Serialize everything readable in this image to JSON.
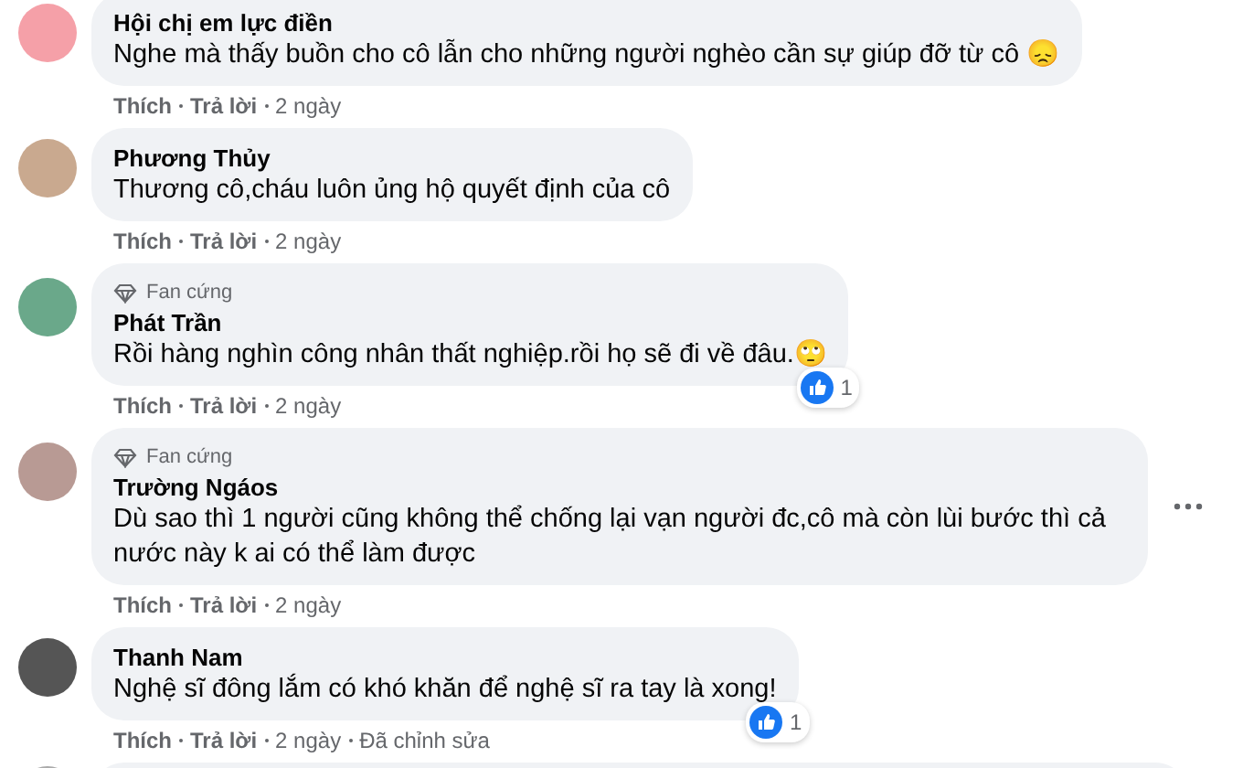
{
  "comments": [
    {
      "author": "Hội chị em lực điền",
      "text": "Nghe mà thấy buồn cho cô lẫn cho những người nghèo cần sự giúp đỡ từ cô 😞",
      "actions": [
        "Thích",
        "Trả lời"
      ],
      "time": "2 ngày",
      "has_menu": false
    },
    {
      "author": "Phương Thủy",
      "text": "Thương cô,cháu luôn ủng hộ quyết định của cô",
      "actions": [
        "Thích",
        "Trả lời"
      ],
      "time": "2 ngày",
      "has_menu": false
    },
    {
      "author": "Phát Trần",
      "badge": "Fan cứng",
      "text": "Rồi hàng nghìn công nhân thất nghiệp.rồi họ sẽ đi về đâu.🙄",
      "actions": [
        "Thích",
        "Trả lời"
      ],
      "time": "2 ngày",
      "reaction_count": "1",
      "has_menu": false
    },
    {
      "author": "Trường Ngáos",
      "badge": "Fan cứng",
      "text": "Dù sao thì 1 người cũng không thể chống lại vạn người đc,cô mà còn lùi bước thì cả nước này k ai có thể làm được",
      "actions": [
        "Thích",
        "Trả lời"
      ],
      "time": "2 ngày",
      "has_menu": true
    },
    {
      "author": "Thanh Nam",
      "text": "Nghệ sĩ đông lắm có khó khăn để nghệ sĩ ra tay là xong!",
      "actions": [
        "Thích",
        "Trả lời"
      ],
      "time": "2 ngày",
      "edited": "Đã chỉnh sửa",
      "reaction_count": "1",
      "has_menu": false
    }
  ]
}
